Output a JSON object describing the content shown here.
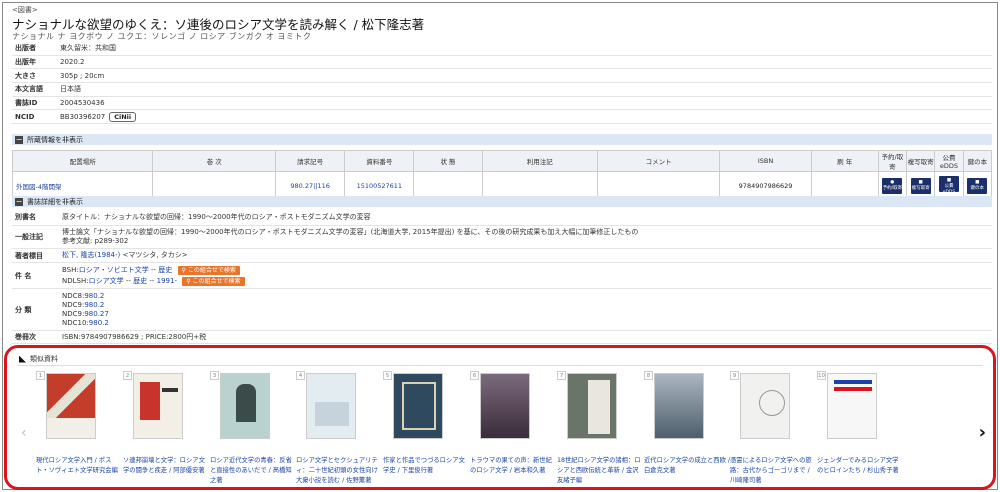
{
  "record": {
    "type_label": "<図書>",
    "title": "ナショナルな欲望のゆくえ：ソ連後のロシア文学を読み解く / 松下隆志著",
    "reading": "ナショナル ナ ヨクボウ ノ ユクエ：ソレンゴ ノ ロシア ブンガク オ ヨミトク"
  },
  "metadata": [
    {
      "key": "出版者",
      "value": "東久留米：共和国"
    },
    {
      "key": "出版年",
      "value": "2020.2"
    },
    {
      "key": "大きさ",
      "value": "305p ; 20cm"
    },
    {
      "key": "本文言語",
      "value": "日本語"
    },
    {
      "key": "書誌ID",
      "value": "2004530436"
    },
    {
      "key": "NCID",
      "value": "BB30396207",
      "badge": "CiNii"
    }
  ],
  "holdings": {
    "toggle_label": "所蔵情報を非表示",
    "columns": [
      "配置場所",
      "巻 次",
      "請求記号",
      "資料番号",
      "状 態",
      "利用注記",
      "コメント",
      "ISBN",
      "刷 年",
      "予約/取寄",
      "複写取寄",
      "公費eDDS",
      "鍵の本"
    ],
    "row": {
      "location": "外国図-4階開架",
      "volume": "",
      "call_number": "980.27||116",
      "item_number": "15100527611",
      "status": "",
      "note": "",
      "comment": "",
      "isbn": "9784907986629",
      "print_year": "",
      "buttons": [
        "予約/取寄",
        "複写取寄",
        "公費eDDS",
        "鍵の本"
      ]
    }
  },
  "bibliography": {
    "toggle_label": "書誌詳細を非表示",
    "alt_title_key": "別書名",
    "alt_title": "原タイトル：ナショナルな欲望の回帰：1990～2000年代のロシア・ポストモダニズム文学の変容",
    "general_note_key": "一般注記",
    "general_note_1": "博士論文「ナショナルな欲望の回帰：1990～2000年代のロシア・ポストモダニズム文学の変容」(北海道大学, 2015年提出) を基に、その後の研究成果も加え大幅に加筆修正したもの",
    "general_note_2": "参考文献: p289-302",
    "author_key": "著者標目",
    "author_link": "松下, 隆志(1984-)",
    "author_reading": " <マツシタ, タカシ>",
    "subject_key": "件 名",
    "subject_1_prefix": "BSH:",
    "subject_1_a": "ロシア・ソビエト文学",
    "subject_1_b": "歴史",
    "subject_2_prefix": "NDLSH:",
    "subject_2_a": "ロシア文学",
    "subject_2_b": "歴史",
    "subject_2_c": "1991-",
    "sep": " -- ",
    "combo_btn": "この組合せで検索",
    "class_key": "分 類",
    "class": [
      {
        "scheme": "NDC8:",
        "num": "980.2"
      },
      {
        "scheme": "NDC9:",
        "num": "980.2"
      },
      {
        "scheme": "NDC9:",
        "num": "980.27"
      },
      {
        "scheme": "NDC10:",
        "num": "980.2"
      }
    ],
    "std_key": "書誌ID",
    "std_key_display": "巻冊次",
    "std_value": "ISBN:9784907986629 ; PRICE:2800円+税"
  },
  "similar": {
    "heading": "類似資料",
    "items": [
      {
        "num": "1",
        "caption": "現代ロシア文学入門 / ポスト・ソヴィエト文学研究会編",
        "cover_color": "#c43d2a"
      },
      {
        "num": "2",
        "caption": "ソ連邦崩壊と文学：ロシア文学の闘争と疾走 / 阿部優安著",
        "cover_color": "#f4efe6"
      },
      {
        "num": "3",
        "caption": "ロシア近代文学の青春：反省と直接性のあいだで / 髙橋知之著",
        "cover_color": "#b9d2d0"
      },
      {
        "num": "4",
        "caption": "ロシア文学とセクシュアリティ：二十世紀初頭の女性向け大衆小説を読む / 佐野薫著",
        "cover_color": "#e3ecf1"
      },
      {
        "num": "5",
        "caption": "作家と作品でつづるロシア文学史 / 下里俊行著",
        "cover_color": "#2f4a5e"
      },
      {
        "num": "6",
        "caption": "トラウマの果ての声：新世紀のロシア文学 / 岩本和久著",
        "cover_color": "#4e3c4b"
      },
      {
        "num": "7",
        "caption": "18世紀ロシア文学の諸相：ロシアと西欧伝統と革新 / 金沢友緒子編",
        "cover_color": "#6a7468"
      },
      {
        "num": "8",
        "caption": "近代ロシア文学の成立と西欧 / 白倉克文著",
        "cover_color": "#6b7c8c"
      },
      {
        "num": "9",
        "caption": "憑霊によるロシア文学への旅路：古代からゴーゴリまで / 川崎隆司著",
        "cover_color": "#f1f1ef"
      },
      {
        "num": "10",
        "caption": "ジェンダーでみるロシア文学のヒロインたち / 杉山秀子著",
        "cover_color": "#f7f7f7"
      }
    ]
  }
}
